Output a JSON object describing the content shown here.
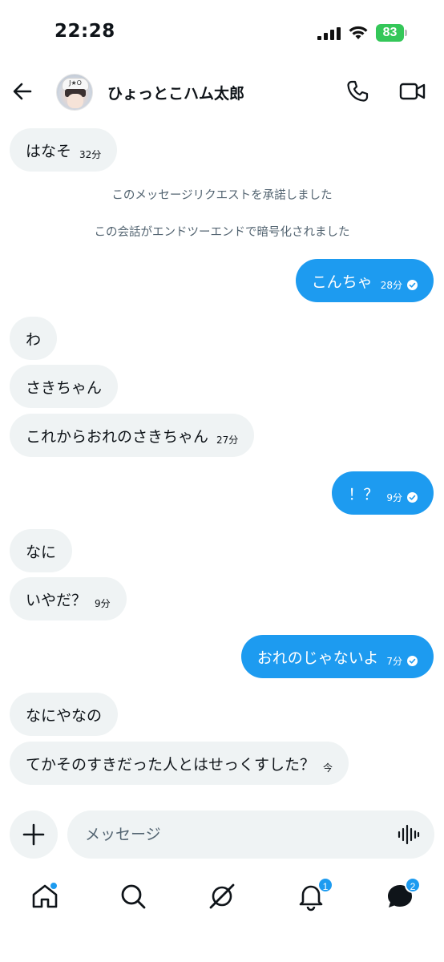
{
  "status_bar": {
    "time": "22:28",
    "battery": "83"
  },
  "header": {
    "contact_name": "ひょっとこハム太郎",
    "avatar_cap_text": "J★O"
  },
  "messages": [
    {
      "text": "はなそ",
      "time": "32分"
    },
    {
      "text": "このメッセージリクエストを承諾しました"
    },
    {
      "text": "この会話がエンドツーエンドで暗号化されました"
    },
    {
      "text": "こんちゃ",
      "time": "28分"
    },
    {
      "text": "わ"
    },
    {
      "text": "さきちゃん"
    },
    {
      "text": "これからおれのさきちゃん",
      "time": "27分"
    },
    {
      "text": "！？",
      "time": "9分"
    },
    {
      "text": "なに"
    },
    {
      "text": "いやだ？",
      "time": "9分"
    },
    {
      "text": "おれのじゃないよ",
      "time": "7分"
    },
    {
      "text": "なにやなの"
    },
    {
      "text": "てかそのすきだった人とはせっくすした？",
      "time": "今"
    }
  ],
  "composer": {
    "placeholder": "メッセージ"
  },
  "nav": {
    "notifications_badge": "1",
    "messages_badge": "2"
  },
  "colors": {
    "accent": "#1d9bf0",
    "incoming_bubble": "#eff3f4",
    "battery": "#34c759"
  }
}
